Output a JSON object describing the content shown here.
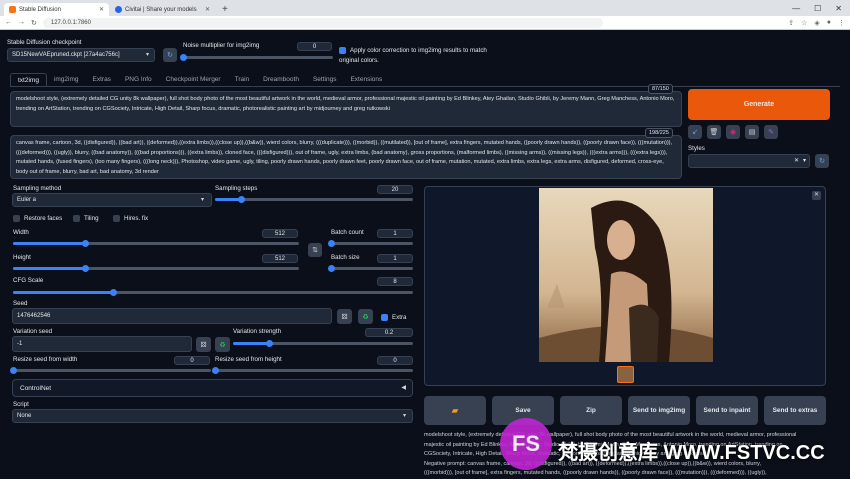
{
  "browser": {
    "tabs": [
      {
        "label": "Stable Diffusion",
        "active": true
      },
      {
        "label": "Civitai | Share your models",
        "active": false
      }
    ],
    "url": "127.0.0.1:7860"
  },
  "top": {
    "checkpoint_label": "Stable Diffusion checkpoint",
    "checkpoint_value": "SD15NewVAEpruned.ckpt [27a4ac756c]",
    "noise_label": "Noise multiplier for img2img",
    "noise_value": "0",
    "noise_level": 0,
    "color_correction": "Apply color correction to img2img results to match original colors."
  },
  "tabs": [
    "txt2img",
    "img2img",
    "Extras",
    "PNG Info",
    "Checkpoint Merger",
    "Train",
    "Dreambooth",
    "Settings",
    "Extensions"
  ],
  "prompt": {
    "text": "modelshoot style, (extremely detailed CG unity 8k wallpaper), full shot body photo of the most beautiful artwork in the world, medieval armor, professional majestic oil painting by Ed Blinkey, Atey Ghailan, Studio Ghibli, by Jeremy Mann, Greg Manchess, Antonio Moro, trending on ArtStation, trending on CGSociety, Intricate, High Detail, Sharp focus, dramatic, photorealistic painting art by midjourney and greg rutkowski",
    "count": "87/150"
  },
  "negative": {
    "text": "canvas frame, cartoon, 3d, ((disfigured)), ((bad art)), ((deformed)),((extra limbs)),((close up)),((b&w)), wierd colors, blurry, (((duplicate))), ((morbid)), ((mutilated)), [out of frame], extra fingers, mutated hands, ((poorly drawn hands)), ((poorly drawn face)), (((mutation))), (((deformed))), ((ugly)), blurry, ((bad anatomy)), (((bad proportions))), ((extra limbs)), cloned face, (((disfigured))), out of frame, ugly, extra limbs, (bad anatomy), gross proportions, (malformed limbs), ((missing arms)), ((missing legs)), (((extra arms))), (((extra legs))), mutated hands, (fused fingers), (too many fingers), (((long neck))), Photoshop, video game, ugly, tiling, poorly drawn hands, poorly drawn feet, poorly drawn face, out of frame, mutation, mutated, extra limbs, extra legs, extra arms, disfigured, deformed, cross-eye, body out of frame, blurry, bad art, bad anatomy, 3d render",
    "count": "198/225"
  },
  "generate": "Generate",
  "styles_label": "Styles",
  "sampling": {
    "method_label": "Sampling method",
    "method": "Euler a",
    "steps_label": "Sampling steps",
    "steps": "20",
    "steps_level": 0.13
  },
  "checks": {
    "restore": "Restore faces",
    "tiling": "Tiling",
    "hires": "Hires. fix"
  },
  "size": {
    "width_label": "Width",
    "width": "512",
    "width_level": 0.25,
    "height_label": "Height",
    "height": "512",
    "height_level": 0.25,
    "batch_count_label": "Batch count",
    "batch_count": "1",
    "batch_count_level": 0,
    "batch_size_label": "Batch size",
    "batch_size": "1",
    "batch_size_level": 0
  },
  "cfg": {
    "label": "CFG Scale",
    "value": "8",
    "level": 0.25
  },
  "seed": {
    "label": "Seed",
    "value": "1476462546",
    "extra": "Extra",
    "var_label": "Variation seed",
    "var_value": "-1",
    "strength_label": "Variation strength",
    "strength_value": "0.2",
    "strength_level": 0.2,
    "rw_label": "Resize seed from width",
    "rw_value": "0",
    "rh_label": "Resize seed from height",
    "rh_value": "0"
  },
  "controlnet": "ControlNet",
  "script_label": "Script",
  "script_value": "None",
  "actions": [
    "Save",
    "Zip",
    "Send to img2img",
    "Send to inpaint",
    "Send to extras"
  ],
  "info": [
    "modelshoot style, (extremely detailed CG unity 8k wallpaper), full shot body photo of the most beautiful artwork in the world, medieval armor, professional",
    "majestic oil painting by Ed Blinkey, Atey Ghailan, Studio Ghibli, by Jeremy Mann, Greg Manchess, Antonio Moro, trending on ArtStation, trending on",
    "CGSociety, Intricate, High Detail, Sharp focus, dramatic, photorealistic painting art by midjourney and greg rutkowski",
    "Negative prompt: canvas frame, cartoon, 3d, ((disfigured)), ((bad art)), ((deformed)),((extra limbs)),((close up)),((b&w)), wierd colors, blurry,",
    "(((morbid))), [out of frame], extra fingers, mutated hands, ((poorly drawn hands)), ((poorly drawn face)), (((mutation))), (((deformed))), ((ugly)),"
  ],
  "watermark": {
    "logo": "FS",
    "text": "梵摄创意库 WWW.FSTVC.CC"
  }
}
